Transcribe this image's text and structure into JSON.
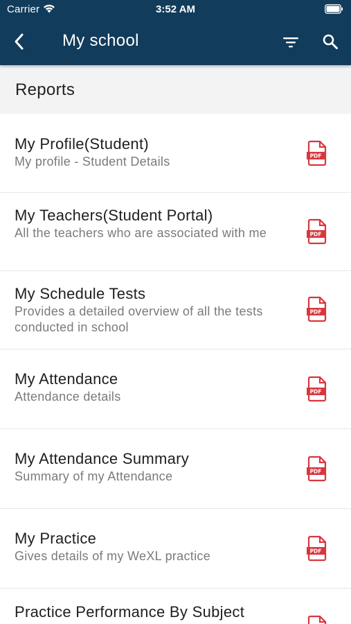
{
  "status_bar": {
    "carrier": "Carrier",
    "time": "3:52 AM"
  },
  "navbar": {
    "title": "My school",
    "back_icon": "chevron-left-icon",
    "filter_icon": "filter-icon",
    "search_icon": "search-icon"
  },
  "section": {
    "title": "Reports"
  },
  "reports": [
    {
      "title": "My Profile(Student)",
      "subtitle": "My profile - Student Details",
      "icon": "pdf-icon"
    },
    {
      "title": "My Teachers(Student Portal)",
      "subtitle": "All the teachers who are associated with me",
      "icon": "pdf-icon"
    },
    {
      "title": "My Schedule Tests",
      "subtitle": "Provides a detailed overview of all the tests conducted in school",
      "icon": "pdf-icon"
    },
    {
      "title": "My Attendance",
      "subtitle": "Attendance details",
      "icon": "pdf-icon"
    },
    {
      "title": "My Attendance Summary",
      "subtitle": "Summary of my Attendance",
      "icon": "pdf-icon"
    },
    {
      "title": "My Practice",
      "subtitle": "Gives details of my WeXL practice",
      "icon": "pdf-icon"
    },
    {
      "title": "Practice Performance By Subject",
      "subtitle": "",
      "icon": "pdf-icon"
    }
  ],
  "colors": {
    "header_bg": "#123c5b",
    "pdf_red": "#d9363e",
    "section_bg": "#f3f3f3"
  }
}
